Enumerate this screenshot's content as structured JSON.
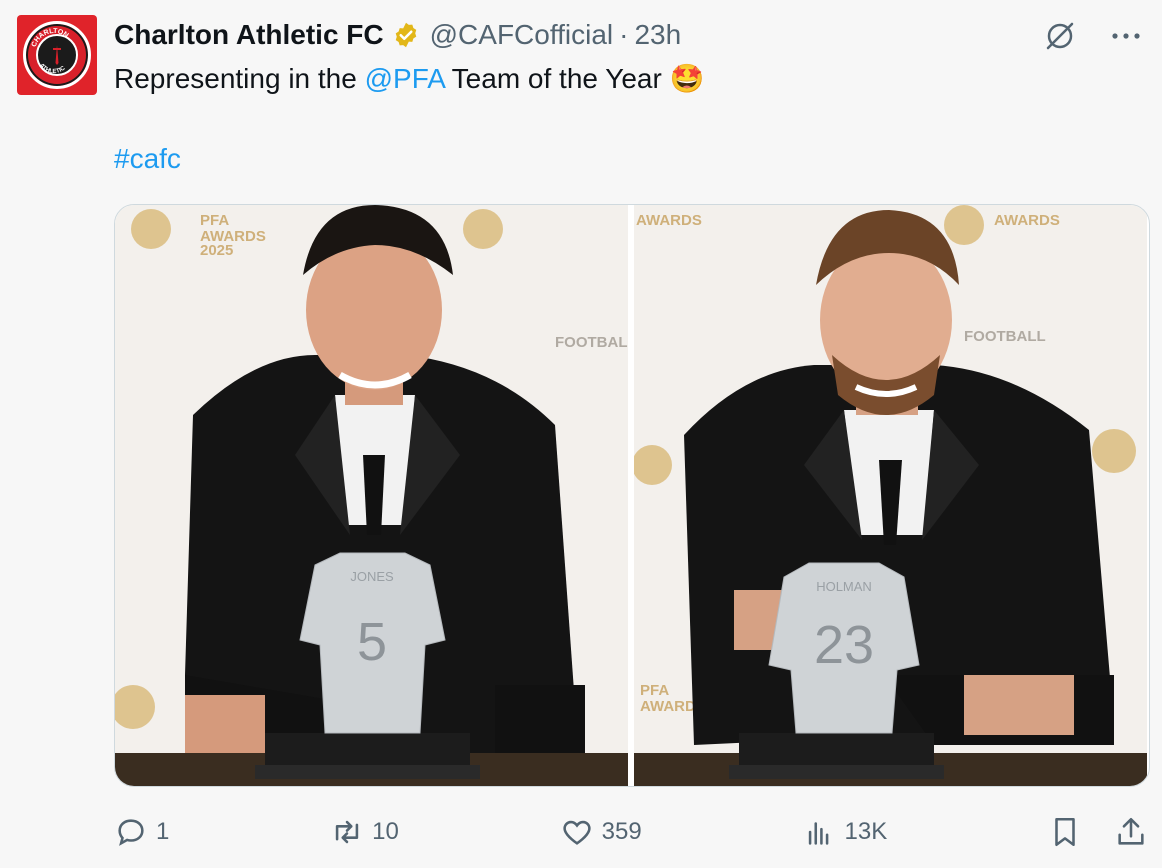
{
  "author": {
    "name": "Charlton Athletic FC",
    "handle": "@CAFCofficial",
    "time": "23h",
    "avatar_text_top": "CHARLTON",
    "avatar_text_bottom": "ATHLETIC"
  },
  "tweet": {
    "text_before": "Representing in the ",
    "mention": "@PFA",
    "text_after": " Team of the Year ",
    "emoji": "🤩",
    "hashtag": "#cafc"
  },
  "media": {
    "photos": [
      {
        "shirt_name": "JONES",
        "shirt_number": "5"
      },
      {
        "shirt_name": "HOLMAN",
        "shirt_number": "23"
      }
    ],
    "backdrop_text": [
      "PFA",
      "AWARDS",
      "2025",
      "FOOTBALL"
    ]
  },
  "actions": {
    "replies": "1",
    "reposts": "10",
    "likes": "359",
    "views": "13K"
  },
  "colors": {
    "accent": "#1d9bf0",
    "muted": "#536471",
    "brand_red": "#e0232a"
  }
}
